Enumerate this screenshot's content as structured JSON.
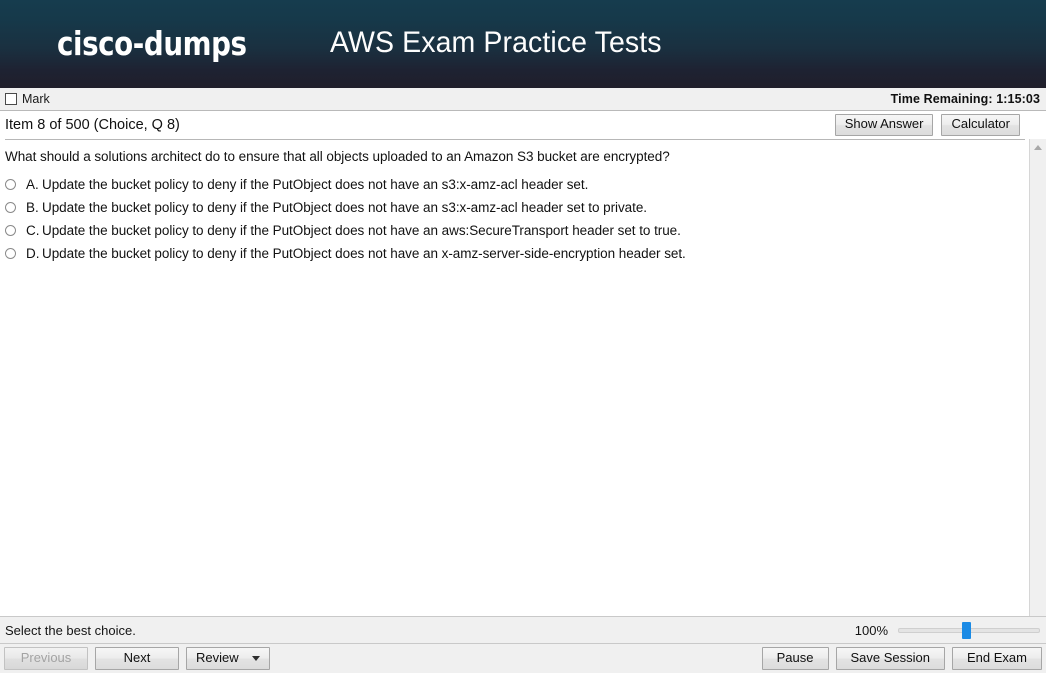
{
  "banner": {
    "logo": "cisco-dumps",
    "title": "AWS Exam Practice Tests"
  },
  "markbar": {
    "mark_label": "Mark",
    "timer_label": "Time Remaining: 1:15:03"
  },
  "item_header": {
    "title": "Item 8 of 500 (Choice, Q 8)",
    "show_answer_label": "Show Answer",
    "calculator_label": "Calculator"
  },
  "question": {
    "text": "What should a solutions architect do to ensure that all objects uploaded to an Amazon S3 bucket are encrypted?",
    "options": [
      {
        "letter": "A.",
        "text": "Update the bucket policy to deny if the PutObject does not have an s3:x-amz-acl header set.",
        "selected": false
      },
      {
        "letter": "B.",
        "text": "Update the bucket policy to deny if the PutObject does not have an s3:x-amz-acl header set to private.",
        "selected": false
      },
      {
        "letter": "C.",
        "text": "Update the bucket policy to deny if the PutObject does not have an aws:SecureTransport header set to true.",
        "selected": false
      },
      {
        "letter": "D.",
        "text": "Update the bucket policy to deny if the PutObject does not have an x-amz-server-side-encryption header set.",
        "selected": false
      }
    ]
  },
  "statusbar": {
    "hint": "Select the best choice.",
    "zoom_percent": "100%"
  },
  "toolbar": {
    "previous_label": "Previous",
    "next_label": "Next",
    "review_label": "Review",
    "pause_label": "Pause",
    "save_session_label": "Save Session",
    "end_exam_label": "End Exam"
  },
  "colors": {
    "banner_top": "#163c4e",
    "banner_bottom": "#201f2b",
    "slider_thumb": "#1a8ae5",
    "chrome": "#f0f0f0"
  }
}
